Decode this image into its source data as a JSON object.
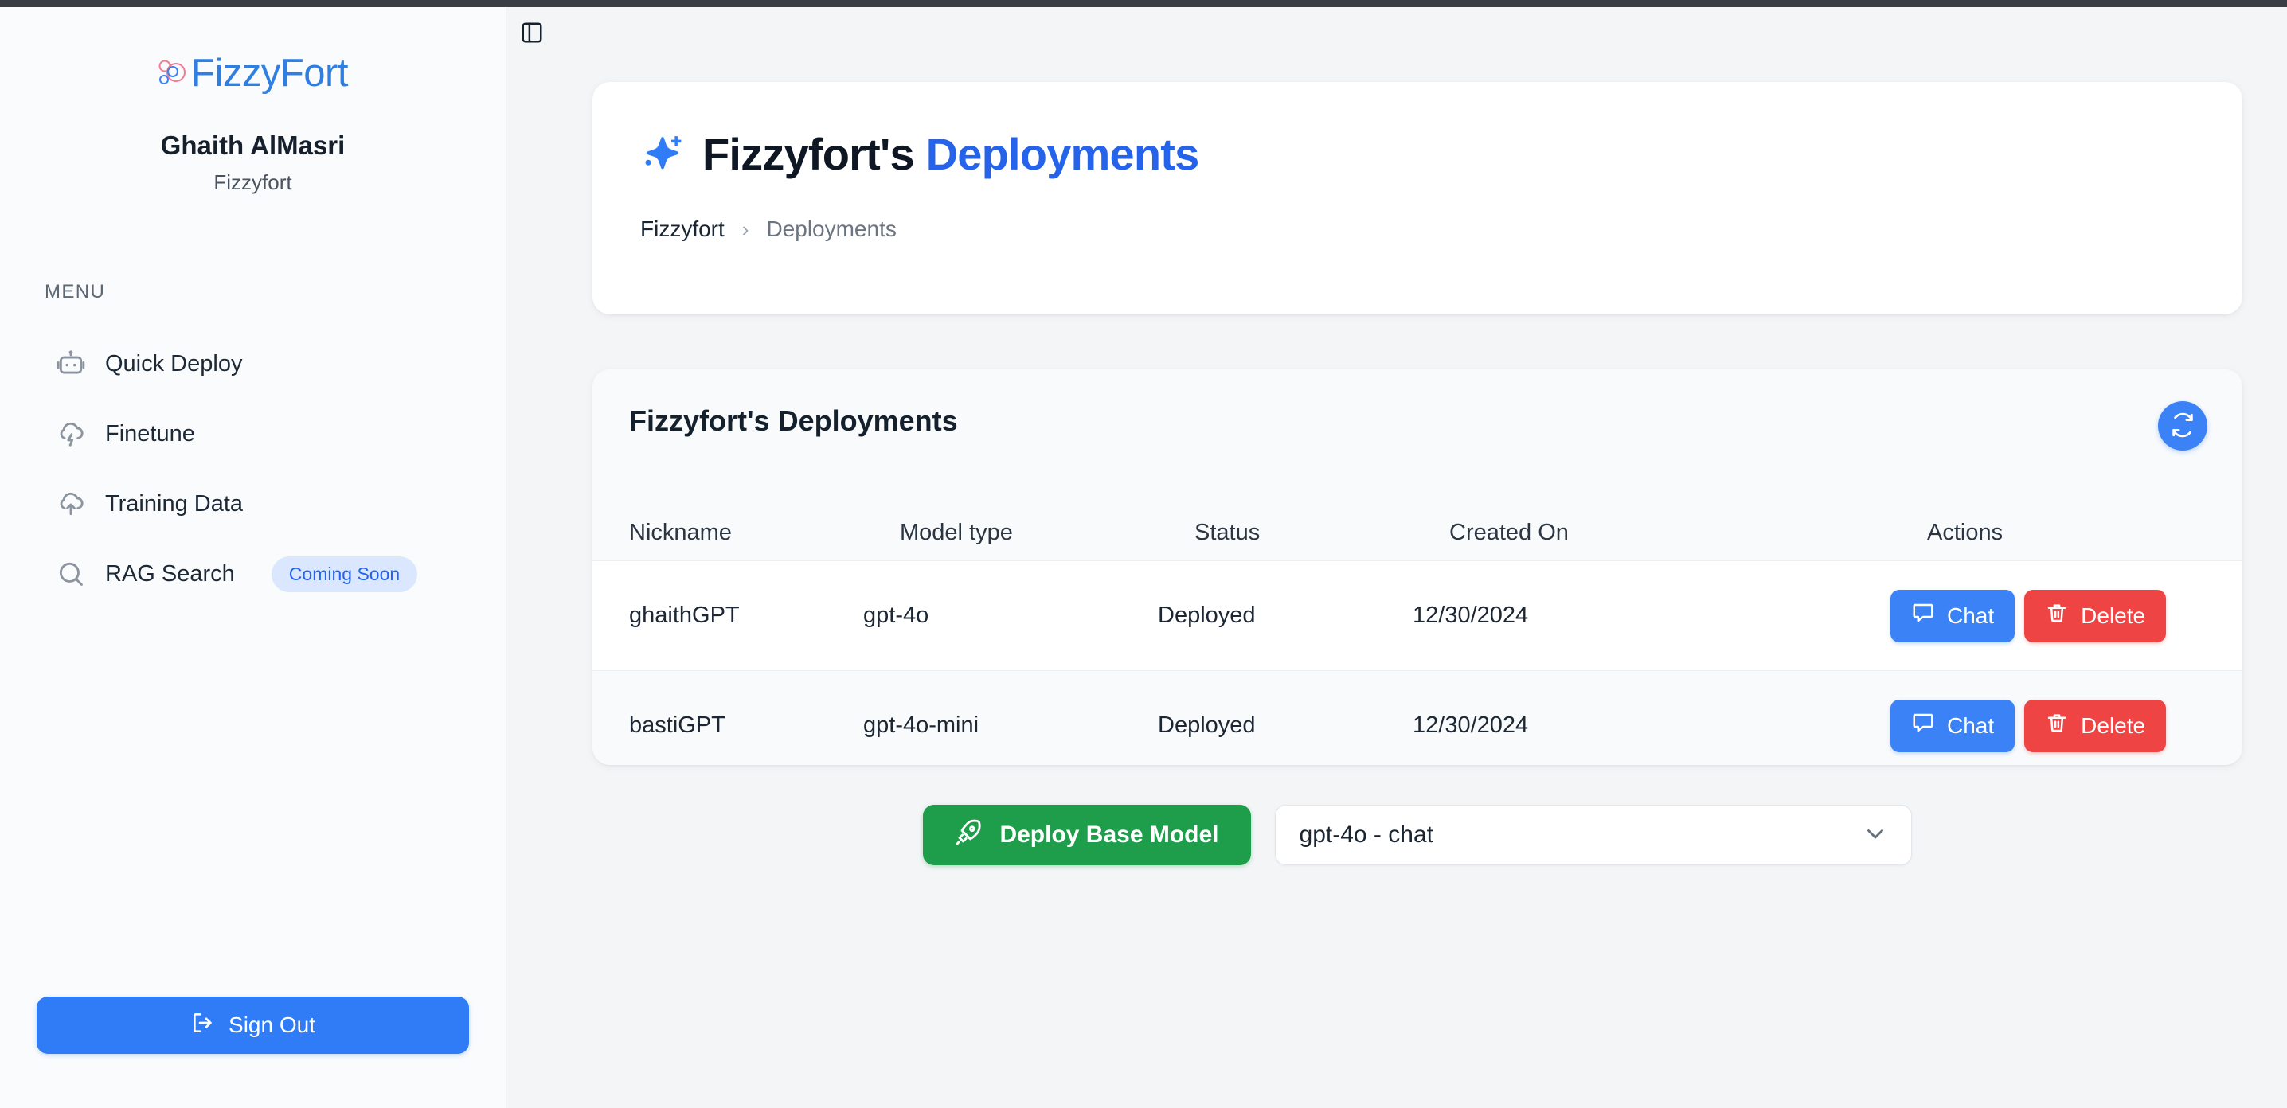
{
  "brand": {
    "logo_text": "FizzyFort"
  },
  "sidebar": {
    "user_name": "Ghaith AlMasri",
    "org_name": "Fizzyfort",
    "menu_label": "MENU",
    "items": [
      {
        "label": "Quick Deploy",
        "icon": "robot-icon",
        "badge": null
      },
      {
        "label": "Finetune",
        "icon": "cloud-lightning-icon",
        "badge": null
      },
      {
        "label": "Training Data",
        "icon": "cloud-upload-icon",
        "badge": null
      },
      {
        "label": "RAG Search",
        "icon": "search-icon",
        "badge": "Coming Soon"
      }
    ],
    "sign_out_label": "Sign Out"
  },
  "header": {
    "title_prefix": "Fizzyfort's",
    "title_accent": "Deployments",
    "breadcrumb": {
      "root": "Fizzyfort",
      "separator": "›",
      "current": "Deployments"
    }
  },
  "deployments_panel": {
    "title": "Fizzyfort's Deployments",
    "columns": [
      "Nickname",
      "Model type",
      "Status",
      "Created On",
      "Actions"
    ],
    "rows": [
      {
        "nickname": "ghaithGPT",
        "model_type": "gpt-4o",
        "status": "Deployed",
        "created_on": "12/30/2024",
        "chat_label": "Chat",
        "delete_label": "Delete"
      },
      {
        "nickname": "bastiGPT",
        "model_type": "gpt-4o-mini",
        "status": "Deployed",
        "created_on": "12/30/2024",
        "chat_label": "Chat",
        "delete_label": "Delete"
      }
    ]
  },
  "controls": {
    "deploy_label": "Deploy Base Model",
    "model_selected": "gpt-4o - chat"
  },
  "colors": {
    "brand_blue": "#2f7fe0",
    "accent_blue": "#2563eb",
    "button_blue": "#3b82f6",
    "danger_red": "#ef4444",
    "success_green": "#15a34a",
    "deploy_green": "#1e9e4a",
    "badge_bg": "#dbe7fe",
    "page_bg": "#f4f5f7"
  }
}
